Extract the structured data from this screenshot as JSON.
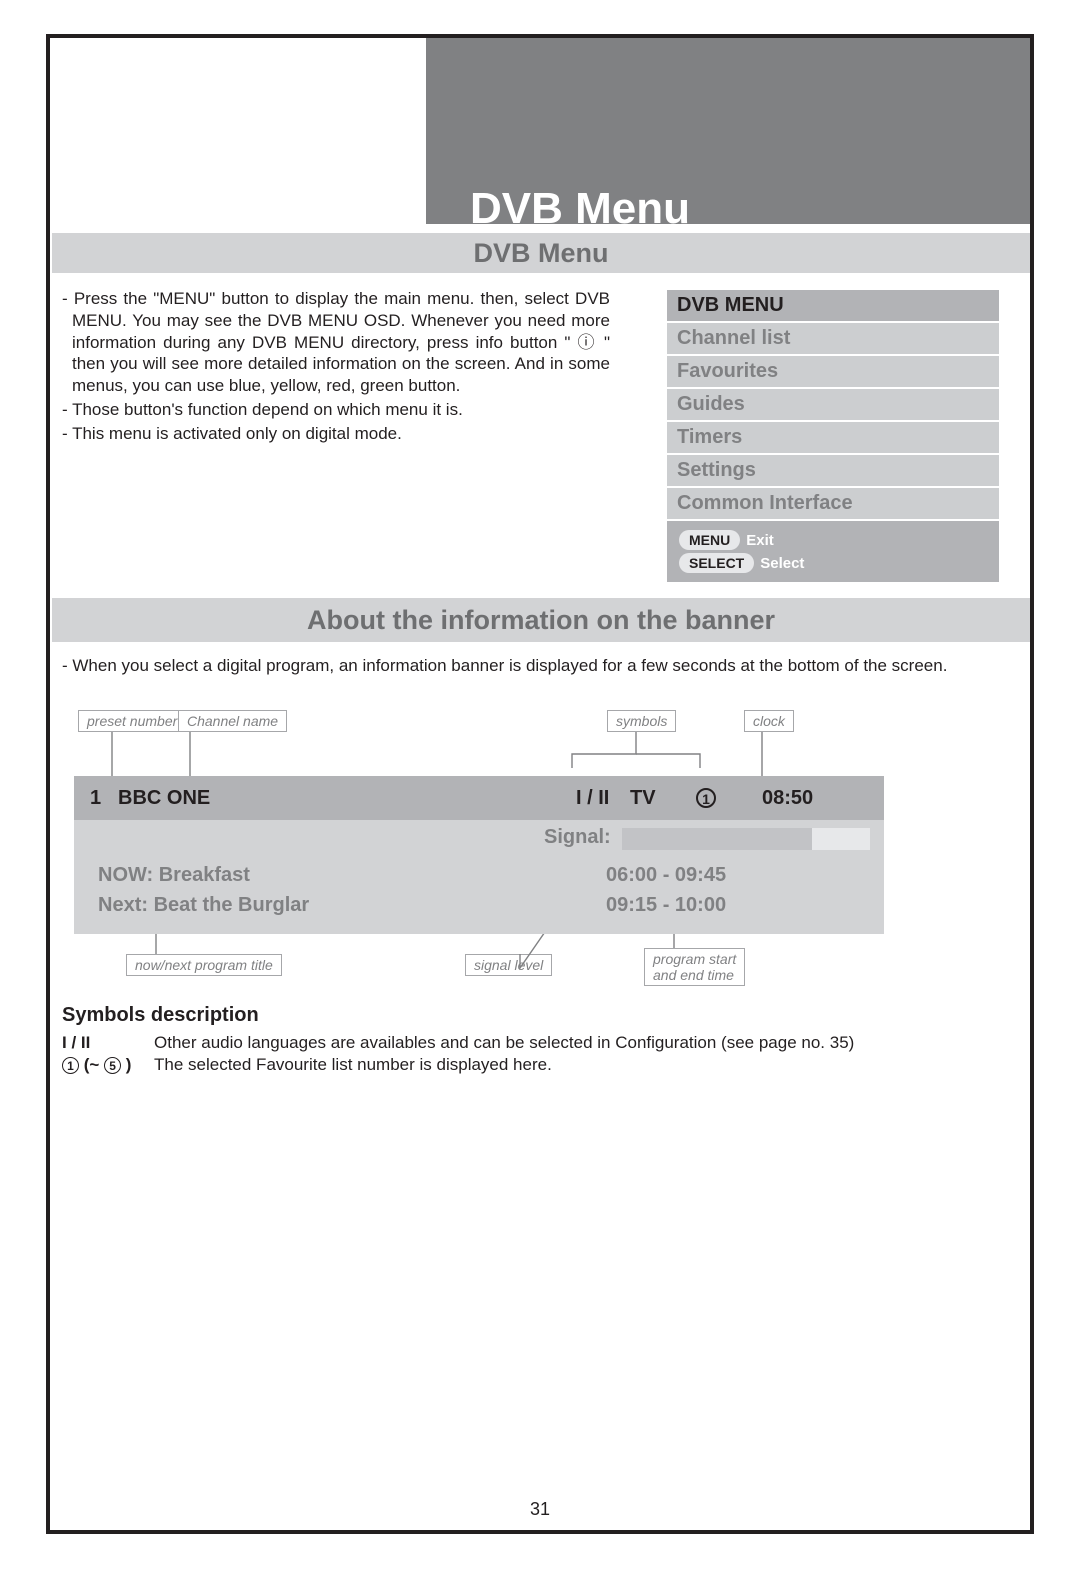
{
  "hero_title": "DVB Menu",
  "section1": "DVB Menu",
  "intro": {
    "p1": "- Press the \"MENU\" button to display the main menu. then, select DVB MENU. You may see the DVB MENU OSD. Whenever you need more information during any DVB MENU directory, press info button \" ⓘ \" then you will see more detailed information on the screen. And in some menus, you can use blue, yellow, red, green button.",
    "p2": "- Those button's function depend on which menu it is.",
    "p3": "- This menu is activated only on digital mode."
  },
  "menu": {
    "title": "DVB MENU",
    "items": [
      "Channel list",
      "Favourites",
      "Guides",
      "Timers",
      "Settings",
      "Common Interface"
    ],
    "foot": {
      "menu_pill": "MENU",
      "menu_label": "Exit",
      "select_pill": "SELECT",
      "select_label": "Select"
    }
  },
  "section2": "About the information on the banner",
  "banner_intro": "- When you select a digital program, an information banner is displayed for a few seconds at the bottom of the screen.",
  "ann": {
    "preset": "preset number",
    "chname": "Channel name",
    "symbols": "symbols",
    "clock": "clock",
    "signal": "signal level",
    "nownext": "now/next program title",
    "startend": "program start\nand end time"
  },
  "banner": {
    "preset": "1",
    "channel": "BBC ONE",
    "sym_audio": "I / II",
    "sym_tv": "TV",
    "sym_fav": "1",
    "clock": "08:50",
    "signal_label": "Signal:",
    "now_label": "NOW: Breakfast",
    "now_time": "06:00 - 09:45",
    "next_label": "Next: Beat the Burglar",
    "next_time": "09:15 - 10:00"
  },
  "symdesc": {
    "heading": "Symbols description",
    "r1_key": "I / II",
    "r1_txt": "Other audio languages are availables and can be selected in Configuration (see page no. 35)",
    "r2_k1": "1",
    "r2_mid": "(~",
    "r2_k2": "5",
    "r2_close": ")",
    "r2_txt": "The selected Favourite list number is displayed here."
  },
  "page_number": "31"
}
